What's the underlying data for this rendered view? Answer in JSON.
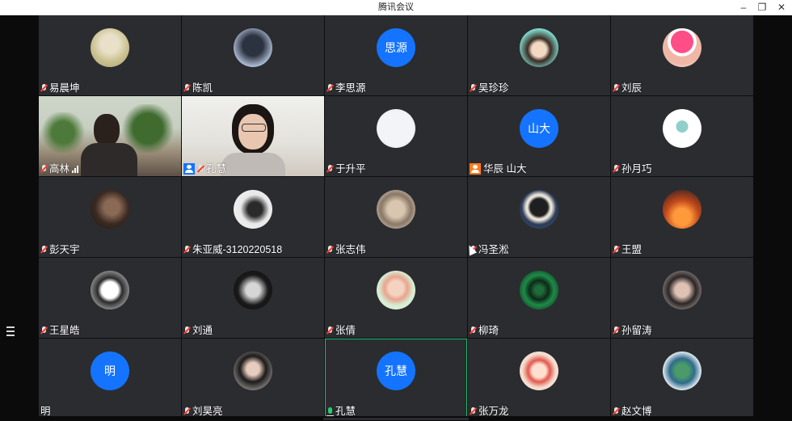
{
  "window": {
    "title": "腾讯会议",
    "minimize_glyph": "–",
    "restore_glyph": "❐",
    "close_glyph": "✕"
  },
  "colors": {
    "tile_bg": "#2b2c30",
    "avatar_blue": "#1474ff",
    "speaking_border": "#18c06b",
    "muted_red": "#ff3b30"
  },
  "participants": [
    {
      "name": "易晨坤",
      "mic": "muted",
      "avatar": "photo-avatar"
    },
    {
      "name": "陈凯",
      "mic": "muted",
      "avatar": "photo-avatar"
    },
    {
      "name": "李思源",
      "mic": "muted",
      "avatar_text": "思源"
    },
    {
      "name": "吴珍珍",
      "mic": "muted",
      "avatar": "cartoon-avatar"
    },
    {
      "name": "刘辰",
      "mic": "muted",
      "avatar": "cartoon-avatar"
    },
    {
      "name": "高林",
      "mic": "muted",
      "video": "camera-video",
      "signal": "signal-icon"
    },
    {
      "name": "孔慧",
      "mic": "muted",
      "video": "camera-video",
      "badge": "host-badge"
    },
    {
      "name": "于升平",
      "mic": "muted",
      "avatar": "photo-avatar"
    },
    {
      "name": "华辰 山大",
      "mic": "none",
      "avatar_text": "山大",
      "badge": "cohost-badge"
    },
    {
      "name": "孙月巧",
      "mic": "muted",
      "avatar": "cartoon-avatar"
    },
    {
      "name": "彭天宇",
      "mic": "muted",
      "avatar": "photo-avatar"
    },
    {
      "name": "朱亚威-3120220518",
      "mic": "muted",
      "avatar": "photo-avatar"
    },
    {
      "name": "张志伟",
      "mic": "muted",
      "avatar": "photo-avatar"
    },
    {
      "name": "冯圣淞",
      "mic": "muted",
      "avatar": "cartoon-avatar"
    },
    {
      "name": "王盟",
      "mic": "muted",
      "avatar": "photo-avatar"
    },
    {
      "name": "王星皓",
      "mic": "muted",
      "avatar": "photo-avatar"
    },
    {
      "name": "刘通",
      "mic": "muted",
      "avatar": "photo-avatar"
    },
    {
      "name": "张倩",
      "mic": "muted",
      "avatar": "cartoon-avatar"
    },
    {
      "name": "柳琦",
      "mic": "muted",
      "avatar": "radar-avatar"
    },
    {
      "name": "孙留涛",
      "mic": "muted",
      "avatar": "photo-avatar"
    },
    {
      "name": "明",
      "mic": "none",
      "avatar_text": "明"
    },
    {
      "name": "刘昊亮",
      "mic": "muted",
      "avatar": "photo-avatar"
    },
    {
      "name": "孔慧",
      "mic": "active",
      "avatar_text": "孔慧",
      "speaking": true
    },
    {
      "name": "张万龙",
      "mic": "muted",
      "avatar": "cartoon-avatar"
    },
    {
      "name": "赵文博",
      "mic": "muted",
      "avatar": "cartoon-avatar"
    }
  ]
}
